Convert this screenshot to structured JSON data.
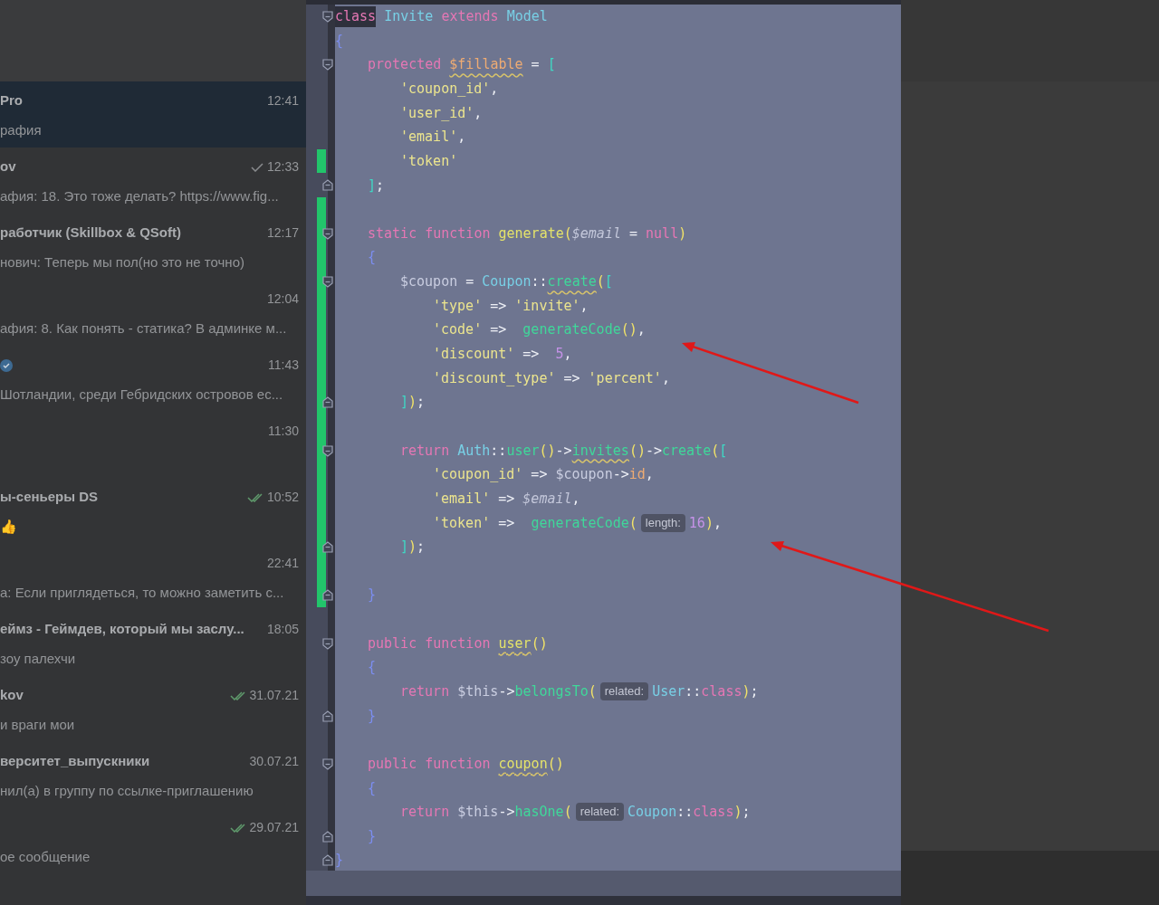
{
  "chat_list": [
    {
      "name": "Pro",
      "preview": "рафия",
      "time": "12:41",
      "selected": true
    },
    {
      "name": "ov",
      "preview": "афия: 18. Это тоже делать? https://www.fig...",
      "time": "12:33",
      "selected": false,
      "read": false
    },
    {
      "name": "работчик (Skillbox & QSoft)",
      "preview": "нович: Теперь мы пол(но это не точно)",
      "time": "12:17",
      "selected": false
    },
    {
      "preview": "афия: 8. Как понять - статика? В админке м...",
      "time": "12:04",
      "selected": false
    },
    {
      "verified": true,
      "preview": "Шотландии, среди Гебридских островов ес...",
      "time": "11:43",
      "selected": false
    },
    {
      "time": "11:30",
      "selected": false
    },
    {
      "name": "ы-сеньеры DS",
      "preview": "👍",
      "time": "10:52",
      "selected": false,
      "read": true
    },
    {
      "preview": "а: Если приглядеться, то можно заметить с...",
      "time": "22:41",
      "selected": false
    },
    {
      "name": "еймз - Геймдев, который мы заслу...",
      "preview": "зоу палехчи",
      "time": "18:05",
      "selected": false
    },
    {
      "name": "kov",
      "preview": "и враги мои",
      "time": "31.07.21",
      "selected": false,
      "read": true
    },
    {
      "name": "верситет_выпускники",
      "preview": "нил(а) в группу по ссылке-приглашению",
      "time": "30.07.21",
      "selected": false
    },
    {
      "preview": "ое сообщение",
      "time": "29.07.21",
      "selected": false,
      "read": true
    }
  ],
  "code_editor": {
    "lines": [
      {
        "kind": "flush",
        "fold_start": true,
        "tokens": [
          {
            "text": "class",
            "kind": "keyword",
            "highlight": true
          },
          {
            "text": " Invite ",
            "kind": "class"
          },
          {
            "text": "extends ",
            "kind": "keyword"
          },
          {
            "text": "Model",
            "kind": "class"
          }
        ]
      },
      {
        "kind": "flush",
        "tokens": [
          {
            "text": "{",
            "kind": "brace"
          }
        ]
      },
      {
        "kind": "indent1",
        "fold_start": true,
        "tokens": [
          {
            "text": "protected ",
            "kind": "keyword"
          },
          {
            "text": "$fillable",
            "kind": "property",
            "warning": true
          },
          {
            "text": " = ",
            "kind": "operator"
          },
          {
            "text": "[",
            "kind": "bracket"
          }
        ]
      },
      {
        "kind": "indent2",
        "tokens": [
          {
            "text": "'coupon_id'",
            "kind": "string"
          },
          {
            "text": ",",
            "kind": "operator"
          }
        ]
      },
      {
        "kind": "indent2",
        "tokens": [
          {
            "text": "'user_id'",
            "kind": "string"
          },
          {
            "text": ",",
            "kind": "operator"
          }
        ]
      },
      {
        "kind": "indent2",
        "tokens": [
          {
            "text": "'email'",
            "kind": "string"
          },
          {
            "text": ",",
            "kind": "operator"
          }
        ]
      },
      {
        "kind": "indent2",
        "changed": true,
        "tokens": [
          {
            "text": "'token'",
            "kind": "string"
          }
        ]
      },
      {
        "kind": "indent1",
        "fold_end": true,
        "tokens": [
          {
            "text": "]",
            "kind": "bracket"
          },
          {
            "text": ";",
            "kind": "operator"
          }
        ]
      },
      {
        "kind": "flush",
        "changed": true
      },
      {
        "kind": "indent1",
        "fold_start": true,
        "changed": true,
        "tokens": [
          {
            "text": "static function ",
            "kind": "keyword"
          },
          {
            "text": "generate",
            "kind": "method"
          },
          {
            "text": "(",
            "kind": "paren"
          },
          {
            "text": "$email",
            "kind": "param"
          },
          {
            "text": " = ",
            "kind": "operator"
          },
          {
            "text": "null",
            "kind": "keyword"
          },
          {
            "text": ")",
            "kind": "paren"
          }
        ]
      },
      {
        "kind": "indent1",
        "changed": true,
        "tokens": [
          {
            "text": "{",
            "kind": "brace"
          }
        ]
      },
      {
        "kind": "indent2",
        "fold_start": true,
        "changed": true,
        "tokens": [
          {
            "text": "$coupon",
            "kind": "variable"
          },
          {
            "text": " = ",
            "kind": "operator"
          },
          {
            "text": "Coupon",
            "kind": "class"
          },
          {
            "text": "::",
            "kind": "operator"
          },
          {
            "text": "create",
            "kind": "function",
            "warning": true
          },
          {
            "text": "(",
            "kind": "paren"
          },
          {
            "text": "[",
            "kind": "bracket"
          }
        ]
      },
      {
        "kind": "indent3",
        "changed": true,
        "tokens": [
          {
            "text": "'type'",
            "kind": "string"
          },
          {
            "text": " => ",
            "kind": "operator"
          },
          {
            "text": "'invite'",
            "kind": "string"
          },
          {
            "text": ",",
            "kind": "operator"
          }
        ]
      },
      {
        "kind": "indent3",
        "changed": true,
        "tokens": [
          {
            "text": "'code'",
            "kind": "string"
          },
          {
            "text": " =>  ",
            "kind": "operator"
          },
          {
            "text": "generateCode",
            "kind": "function"
          },
          {
            "text": "()",
            "kind": "paren"
          },
          {
            "text": ",",
            "kind": "operator"
          }
        ]
      },
      {
        "kind": "indent3",
        "changed": true,
        "tokens": [
          {
            "text": "'discount'",
            "kind": "string"
          },
          {
            "text": " =>  ",
            "kind": "operator"
          },
          {
            "text": "5",
            "kind": "number"
          },
          {
            "text": ",",
            "kind": "operator"
          }
        ]
      },
      {
        "kind": "indent3",
        "changed": true,
        "tokens": [
          {
            "text": "'discount_type'",
            "kind": "string"
          },
          {
            "text": " => ",
            "kind": "operator"
          },
          {
            "text": "'percent'",
            "kind": "string"
          },
          {
            "text": ",",
            "kind": "operator"
          }
        ]
      },
      {
        "kind": "indent2",
        "fold_end": true,
        "changed": true,
        "tokens": [
          {
            "text": "]",
            "kind": "bracket"
          },
          {
            "text": ")",
            "kind": "paren"
          },
          {
            "text": ";",
            "kind": "operator"
          }
        ]
      },
      {
        "kind": "flush",
        "changed": true
      },
      {
        "kind": "indent2",
        "fold_start": true,
        "changed": true,
        "tokens": [
          {
            "text": "return ",
            "kind": "keyword"
          },
          {
            "text": "Auth",
            "kind": "class"
          },
          {
            "text": "::",
            "kind": "operator"
          },
          {
            "text": "user",
            "kind": "function"
          },
          {
            "text": "()",
            "kind": "paren"
          },
          {
            "text": "->",
            "kind": "operator"
          },
          {
            "text": "invites",
            "kind": "function",
            "warning": true
          },
          {
            "text": "()",
            "kind": "paren"
          },
          {
            "text": "->",
            "kind": "operator"
          },
          {
            "text": "create",
            "kind": "function"
          },
          {
            "text": "(",
            "kind": "paren"
          },
          {
            "text": "[",
            "kind": "bracket"
          }
        ]
      },
      {
        "kind": "indent3",
        "changed": true,
        "tokens": [
          {
            "text": "'coupon_id'",
            "kind": "string"
          },
          {
            "text": " => ",
            "kind": "operator"
          },
          {
            "text": "$coupon",
            "kind": "variable"
          },
          {
            "text": "->",
            "kind": "operator"
          },
          {
            "text": "id",
            "kind": "property"
          },
          {
            "text": ",",
            "kind": "operator"
          }
        ]
      },
      {
        "kind": "indent3",
        "changed": true,
        "tokens": [
          {
            "text": "'email'",
            "kind": "string"
          },
          {
            "text": " => ",
            "kind": "operator"
          },
          {
            "text": "$email",
            "kind": "param"
          },
          {
            "text": ",",
            "kind": "operator"
          }
        ]
      },
      {
        "kind": "indent3",
        "changed": true,
        "tokens": [
          {
            "text": "'token'",
            "kind": "string"
          },
          {
            "text": " =>  ",
            "kind": "operator"
          },
          {
            "text": "generateCode",
            "kind": "function"
          },
          {
            "text": "(",
            "kind": "paren"
          },
          {
            "text": "length:",
            "kind": "hint"
          },
          {
            "text": "16",
            "kind": "number"
          },
          {
            "text": ")",
            "kind": "paren"
          },
          {
            "text": ",",
            "kind": "operator"
          }
        ]
      },
      {
        "kind": "indent2",
        "fold_end": true,
        "changed": true,
        "tokens": [
          {
            "text": "]",
            "kind": "bracket"
          },
          {
            "text": ")",
            "kind": "paren"
          },
          {
            "text": ";",
            "kind": "operator"
          }
        ]
      },
      {
        "kind": "flush",
        "changed": true
      },
      {
        "kind": "indent1",
        "fold_end": true,
        "changed": true,
        "tokens": [
          {
            "text": "}",
            "kind": "brace"
          }
        ]
      },
      {
        "kind": "flush"
      },
      {
        "kind": "indent1",
        "fold_start": true,
        "tokens": [
          {
            "text": "public function ",
            "kind": "keyword"
          },
          {
            "text": "user",
            "kind": "method",
            "warning": true
          },
          {
            "text": "()",
            "kind": "paren"
          }
        ]
      },
      {
        "kind": "indent1",
        "tokens": [
          {
            "text": "{",
            "kind": "brace"
          }
        ]
      },
      {
        "kind": "indent2",
        "tokens": [
          {
            "text": "return ",
            "kind": "keyword"
          },
          {
            "text": "$this",
            "kind": "variable"
          },
          {
            "text": "->",
            "kind": "operator"
          },
          {
            "text": "belongsTo",
            "kind": "function"
          },
          {
            "text": "(",
            "kind": "paren"
          },
          {
            "text": "related:",
            "kind": "hint"
          },
          {
            "text": "User",
            "kind": "class"
          },
          {
            "text": "::",
            "kind": "operator"
          },
          {
            "text": "class",
            "kind": "keyword"
          },
          {
            "text": ")",
            "kind": "paren"
          },
          {
            "text": ";",
            "kind": "operator"
          }
        ]
      },
      {
        "kind": "indent1",
        "fold_end": true,
        "tokens": [
          {
            "text": "}",
            "kind": "brace"
          }
        ]
      },
      {
        "kind": "flush"
      },
      {
        "kind": "indent1",
        "fold_start": true,
        "tokens": [
          {
            "text": "public function ",
            "kind": "keyword"
          },
          {
            "text": "coupon",
            "kind": "method",
            "warning": true
          },
          {
            "text": "()",
            "kind": "paren"
          }
        ]
      },
      {
        "kind": "indent1",
        "tokens": [
          {
            "text": "{",
            "kind": "brace"
          }
        ]
      },
      {
        "kind": "indent2",
        "tokens": [
          {
            "text": "return ",
            "kind": "keyword"
          },
          {
            "text": "$this",
            "kind": "variable"
          },
          {
            "text": "->",
            "kind": "operator"
          },
          {
            "text": "hasOne",
            "kind": "function"
          },
          {
            "text": "(",
            "kind": "paren"
          },
          {
            "text": "related:",
            "kind": "hint"
          },
          {
            "text": "Coupon",
            "kind": "class"
          },
          {
            "text": "::",
            "kind": "operator"
          },
          {
            "text": "class",
            "kind": "keyword"
          },
          {
            "text": ")",
            "kind": "paren"
          },
          {
            "text": ";",
            "kind": "operator"
          }
        ]
      },
      {
        "kind": "indent1",
        "fold_end": true,
        "tokens": [
          {
            "text": "}",
            "kind": "brace"
          }
        ]
      },
      {
        "kind": "flush",
        "fold_end": true,
        "tokens": [
          {
            "text": "}",
            "kind": "brace"
          }
        ]
      }
    ]
  }
}
